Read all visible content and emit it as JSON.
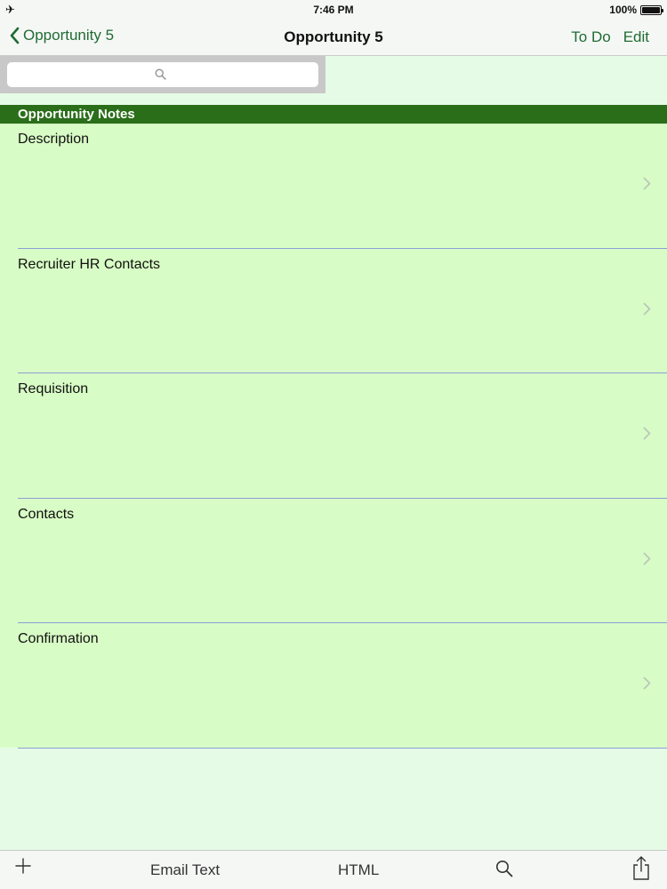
{
  "status_bar": {
    "left_icon": "airplane-icon",
    "left_glyph": "✈",
    "time": "7:46 PM",
    "battery": "100%"
  },
  "nav": {
    "back_label": "Opportunity 5",
    "title": "Opportunity 5",
    "todo_label": "To Do",
    "edit_label": "Edit",
    "accent_color": "#1f6b33"
  },
  "search": {
    "placeholder": "",
    "value": ""
  },
  "section": {
    "title": "Opportunity Notes",
    "header_color": "#2a6e1a"
  },
  "rows": [
    {
      "label": "Description"
    },
    {
      "label": "Recruiter HR Contacts"
    },
    {
      "label": "Requisition"
    },
    {
      "label": "Contacts"
    },
    {
      "label": "Confirmation"
    }
  ],
  "toolbar": {
    "add_glyph": "+",
    "email_label": "Email Text",
    "html_label": "HTML"
  }
}
